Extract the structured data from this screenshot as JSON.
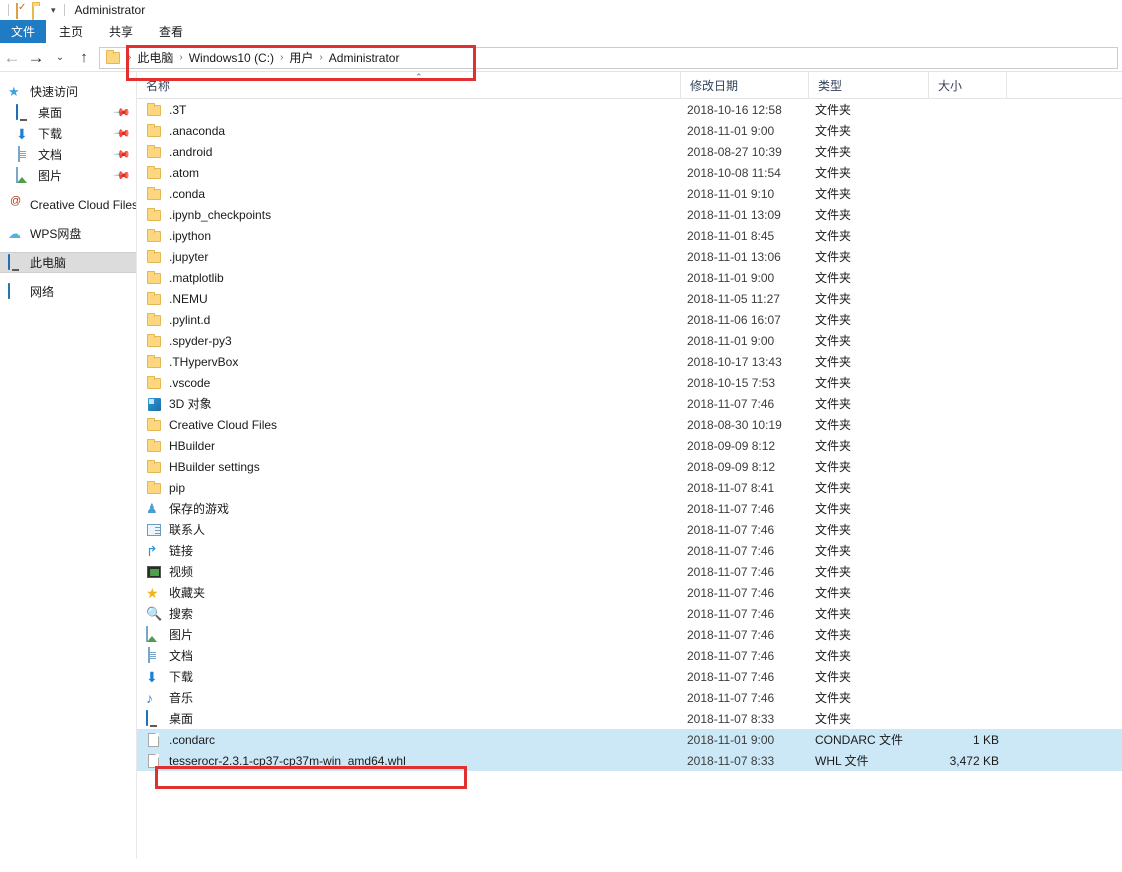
{
  "window": {
    "title": "Administrator",
    "qat": {
      "properties_icon": "properties-icon",
      "newfolder_icon": "new-folder-icon",
      "customize_caret": "▾"
    }
  },
  "ribbon": {
    "tabs": [
      {
        "label": "文件",
        "active": true
      },
      {
        "label": "主页",
        "active": false
      },
      {
        "label": "共享",
        "active": false
      },
      {
        "label": "查看",
        "active": false
      }
    ]
  },
  "nav": {
    "back": "←",
    "forward": "→",
    "history": "⌄",
    "up": "↑",
    "breadcrumb": [
      "此电脑",
      "Windows10 (C:)",
      "用户",
      "Administrator"
    ],
    "separator": "›"
  },
  "sidebar": {
    "items": [
      {
        "label": "快速访问",
        "icon": "quick-access-star-icon",
        "indent": false,
        "pinned": false,
        "active": false
      },
      {
        "label": "桌面",
        "icon": "desktop-icon",
        "indent": true,
        "pinned": true,
        "active": false
      },
      {
        "label": "下载",
        "icon": "downloads-icon",
        "indent": true,
        "pinned": true,
        "active": false
      },
      {
        "label": "文档",
        "icon": "documents-icon",
        "indent": true,
        "pinned": true,
        "active": false
      },
      {
        "label": "图片",
        "icon": "pictures-icon",
        "indent": true,
        "pinned": true,
        "active": false
      },
      {
        "label": "Creative Cloud Files",
        "icon": "creative-cloud-icon",
        "indent": false,
        "pinned": false,
        "active": false
      },
      {
        "label": "WPS网盘",
        "icon": "cloud-icon",
        "indent": false,
        "pinned": false,
        "active": false
      },
      {
        "label": "此电脑",
        "icon": "this-pc-icon",
        "indent": false,
        "pinned": false,
        "active": true
      },
      {
        "label": "网络",
        "icon": "network-icon",
        "indent": false,
        "pinned": false,
        "active": false
      }
    ]
  },
  "columns": {
    "name": "名称",
    "date": "修改日期",
    "type": "类型",
    "size": "大小",
    "sort_indicator": "⌃"
  },
  "files": [
    {
      "name": ".3T",
      "icon": "folder-icon",
      "date": "2018-10-16 12:58",
      "type": "文件夹",
      "size": "",
      "selected": false
    },
    {
      "name": ".anaconda",
      "icon": "folder-icon",
      "date": "2018-11-01 9:00",
      "type": "文件夹",
      "size": "",
      "selected": false
    },
    {
      "name": ".android",
      "icon": "folder-icon",
      "date": "2018-08-27 10:39",
      "type": "文件夹",
      "size": "",
      "selected": false
    },
    {
      "name": ".atom",
      "icon": "folder-icon",
      "date": "2018-10-08 11:54",
      "type": "文件夹",
      "size": "",
      "selected": false
    },
    {
      "name": ".conda",
      "icon": "folder-icon",
      "date": "2018-11-01 9:10",
      "type": "文件夹",
      "size": "",
      "selected": false
    },
    {
      "name": ".ipynb_checkpoints",
      "icon": "folder-icon",
      "date": "2018-11-01 13:09",
      "type": "文件夹",
      "size": "",
      "selected": false
    },
    {
      "name": ".ipython",
      "icon": "folder-icon",
      "date": "2018-11-01 8:45",
      "type": "文件夹",
      "size": "",
      "selected": false
    },
    {
      "name": ".jupyter",
      "icon": "folder-icon",
      "date": "2018-11-01 13:06",
      "type": "文件夹",
      "size": "",
      "selected": false
    },
    {
      "name": ".matplotlib",
      "icon": "folder-icon",
      "date": "2018-11-01 9:00",
      "type": "文件夹",
      "size": "",
      "selected": false
    },
    {
      "name": ".NEMU",
      "icon": "folder-icon",
      "date": "2018-11-05 11:27",
      "type": "文件夹",
      "size": "",
      "selected": false
    },
    {
      "name": ".pylint.d",
      "icon": "folder-icon",
      "date": "2018-11-06 16:07",
      "type": "文件夹",
      "size": "",
      "selected": false
    },
    {
      "name": ".spyder-py3",
      "icon": "folder-icon",
      "date": "2018-11-01 9:00",
      "type": "文件夹",
      "size": "",
      "selected": false
    },
    {
      "name": ".THypervBox",
      "icon": "folder-icon",
      "date": "2018-10-17 13:43",
      "type": "文件夹",
      "size": "",
      "selected": false
    },
    {
      "name": ".vscode",
      "icon": "folder-icon",
      "date": "2018-10-15 7:53",
      "type": "文件夹",
      "size": "",
      "selected": false
    },
    {
      "name": "3D 对象",
      "icon": "3d-objects-icon",
      "date": "2018-11-07 7:46",
      "type": "文件夹",
      "size": "",
      "selected": false
    },
    {
      "name": "Creative Cloud Files",
      "icon": "folder-icon",
      "date": "2018-08-30 10:19",
      "type": "文件夹",
      "size": "",
      "selected": false
    },
    {
      "name": "HBuilder",
      "icon": "folder-icon",
      "date": "2018-09-09 8:12",
      "type": "文件夹",
      "size": "",
      "selected": false
    },
    {
      "name": "HBuilder settings",
      "icon": "folder-icon",
      "date": "2018-09-09 8:12",
      "type": "文件夹",
      "size": "",
      "selected": false
    },
    {
      "name": "pip",
      "icon": "folder-icon",
      "date": "2018-11-07 8:41",
      "type": "文件夹",
      "size": "",
      "selected": false
    },
    {
      "name": "保存的游戏",
      "icon": "saved-games-icon",
      "date": "2018-11-07 7:46",
      "type": "文件夹",
      "size": "",
      "selected": false
    },
    {
      "name": "联系人",
      "icon": "contacts-icon",
      "date": "2018-11-07 7:46",
      "type": "文件夹",
      "size": "",
      "selected": false
    },
    {
      "name": "链接",
      "icon": "links-icon",
      "date": "2018-11-07 7:46",
      "type": "文件夹",
      "size": "",
      "selected": false
    },
    {
      "name": "视频",
      "icon": "videos-icon",
      "date": "2018-11-07 7:46",
      "type": "文件夹",
      "size": "",
      "selected": false
    },
    {
      "name": "收藏夹",
      "icon": "favorites-icon",
      "date": "2018-11-07 7:46",
      "type": "文件夹",
      "size": "",
      "selected": false
    },
    {
      "name": "搜索",
      "icon": "searches-icon",
      "date": "2018-11-07 7:46",
      "type": "文件夹",
      "size": "",
      "selected": false
    },
    {
      "name": "图片",
      "icon": "pictures-icon",
      "date": "2018-11-07 7:46",
      "type": "文件夹",
      "size": "",
      "selected": false
    },
    {
      "name": "文档",
      "icon": "documents-icon",
      "date": "2018-11-07 7:46",
      "type": "文件夹",
      "size": "",
      "selected": false
    },
    {
      "name": "下载",
      "icon": "downloads-icon",
      "date": "2018-11-07 7:46",
      "type": "文件夹",
      "size": "",
      "selected": false
    },
    {
      "name": "音乐",
      "icon": "music-icon",
      "date": "2018-11-07 7:46",
      "type": "文件夹",
      "size": "",
      "selected": false
    },
    {
      "name": "桌面",
      "icon": "desktop-icon",
      "date": "2018-11-07 8:33",
      "type": "文件夹",
      "size": "",
      "selected": false
    },
    {
      "name": ".condarc",
      "icon": "generic-file-icon",
      "date": "2018-11-01 9:00",
      "type": "CONDARC 文件",
      "size": "1 KB",
      "selected": true
    },
    {
      "name": "tesserocr-2.3.1-cp37-cp37m-win_amd64.whl",
      "icon": "generic-file-icon",
      "date": "2018-11-07 8:33",
      "type": "WHL 文件",
      "size": "3,472 KB",
      "selected": true
    }
  ],
  "annotations": {
    "address_highlight_color": "#e03030",
    "file_highlight_color": "#e03030"
  },
  "colors": {
    "accent": "#1f7bc4",
    "selection": "#cce8f7",
    "folder": "#fcd77f"
  }
}
